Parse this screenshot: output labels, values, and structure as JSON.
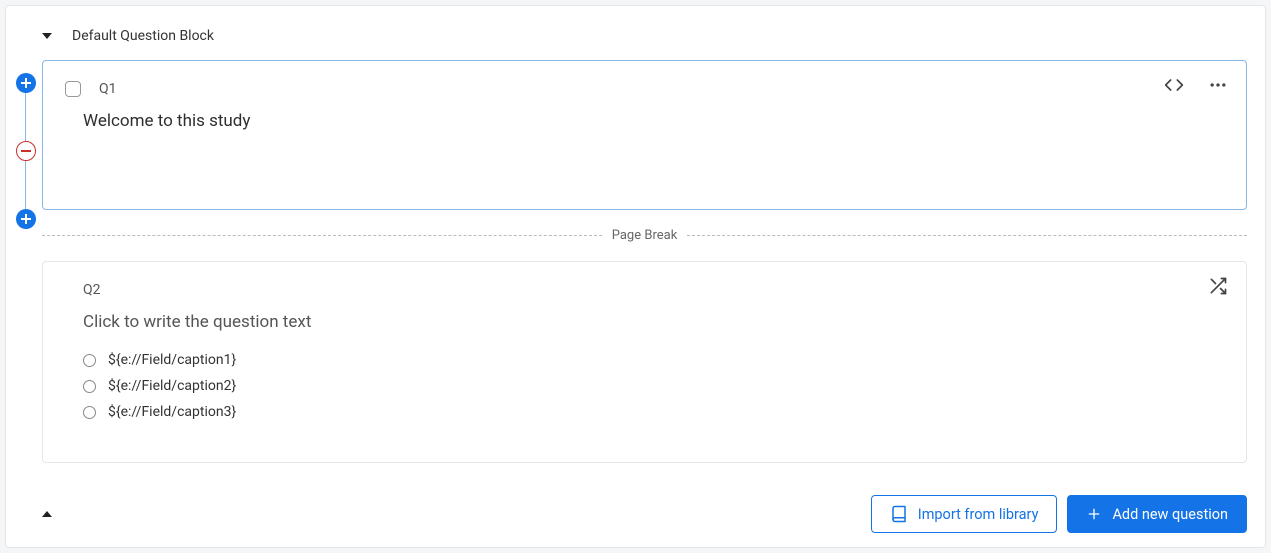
{
  "block": {
    "title": "Default Question Block"
  },
  "q1": {
    "id": "Q1",
    "text": "Welcome to this study"
  },
  "pageBreak": "Page Break",
  "q2": {
    "id": "Q2",
    "placeholder": "Click to write the question text",
    "choices": [
      "${e://Field/caption1}",
      "${e://Field/caption2}",
      "${e://Field/caption3}"
    ]
  },
  "footer": {
    "import_label": "Import from library",
    "add_label": "Add new question"
  }
}
